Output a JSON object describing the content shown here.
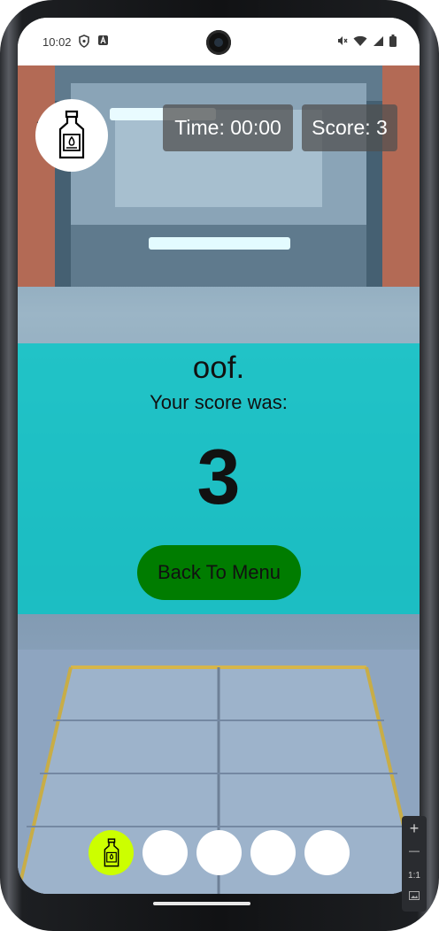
{
  "status_bar": {
    "time": "10:02"
  },
  "hud": {
    "time_text": "Time: 00:00",
    "score_text": "Score: 3"
  },
  "result": {
    "title": "oof.",
    "subtitle": "Your score was:",
    "score": "3",
    "button_label": "Back To Menu"
  },
  "inventory": {
    "slots": [
      "bottle",
      "empty",
      "empty",
      "empty",
      "empty"
    ],
    "active_color": "#ccff00"
  },
  "emulator_toolbar": {
    "plus": "+",
    "minus": "—",
    "ratio": "1:1"
  },
  "colors": {
    "panel": "#00c8c8",
    "button": "#007c00",
    "hud_box": "#505050"
  }
}
